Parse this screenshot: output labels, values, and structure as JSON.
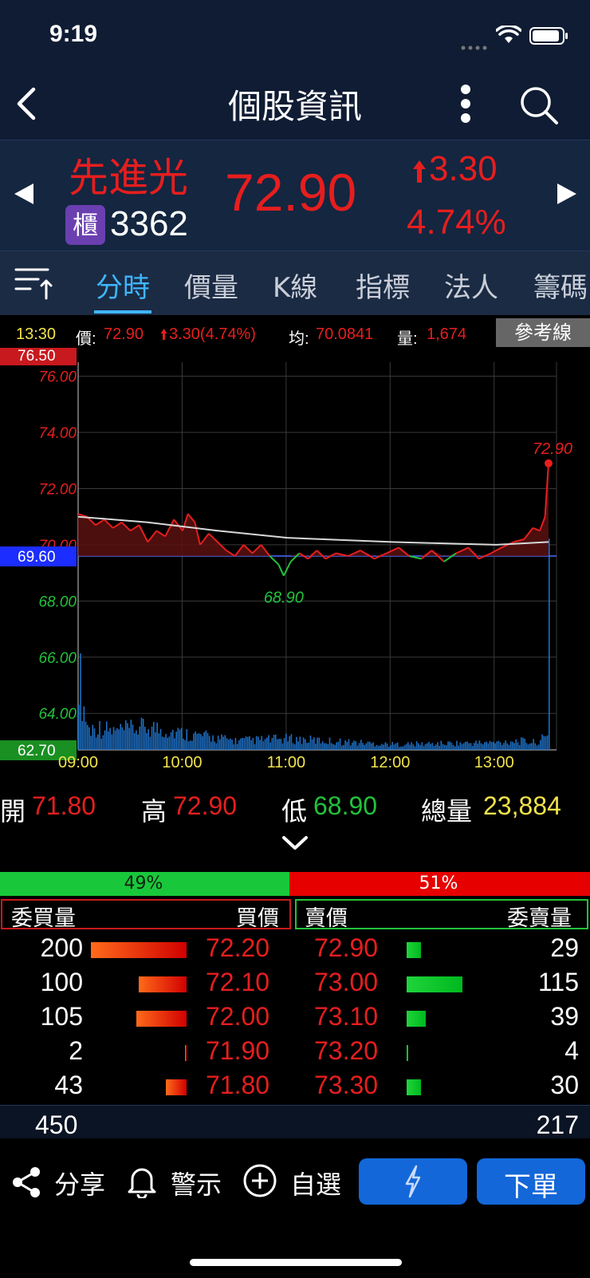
{
  "status": {
    "time": "9:19"
  },
  "nav": {
    "title": "個股資訊"
  },
  "quote": {
    "name": "先進光",
    "market_badge": "櫃",
    "code": "3362",
    "price": "72.90",
    "change": "3.30",
    "change_pct": "4.74%"
  },
  "tabs": [
    "分時",
    "價量",
    "K線",
    "指標",
    "法人",
    "籌碼"
  ],
  "info": {
    "time": "13:30",
    "price_label": "價:",
    "price": "72.90",
    "change": "3.30(4.74%)",
    "avg_label": "均:",
    "avg": "70.0841",
    "vol_label": "量:",
    "vol": "1,674",
    "ref_button": "參考線"
  },
  "chart_data": {
    "type": "line",
    "x_ticks": [
      "09:00",
      "10:00",
      "11:00",
      "12:00",
      "13:00"
    ],
    "y_ticks": [
      "76.00",
      "74.00",
      "72.00",
      "70.00",
      "68.00",
      "66.00",
      "64.00"
    ],
    "ylim": [
      62.7,
      76.5
    ],
    "reference": 69.6,
    "top_label": "76.50",
    "ref_label": "69.60",
    "bottom_label": "62.70",
    "low_label": "68.90",
    "last_label": "72.90",
    "colors": {
      "up": "#e61e1e",
      "down": "#22c23b",
      "avg": "#d8d8d8",
      "volume": "#1e6fc4"
    },
    "price_series": [
      {
        "t": 0,
        "v": 71.1
      },
      {
        "t": 5,
        "v": 71.0
      },
      {
        "t": 10,
        "v": 70.7
      },
      {
        "t": 15,
        "v": 70.9
      },
      {
        "t": 20,
        "v": 70.6
      },
      {
        "t": 25,
        "v": 70.8
      },
      {
        "t": 30,
        "v": 70.5
      },
      {
        "t": 35,
        "v": 70.7
      },
      {
        "t": 40,
        "v": 70.1
      },
      {
        "t": 45,
        "v": 70.5
      },
      {
        "t": 50,
        "v": 70.3
      },
      {
        "t": 55,
        "v": 70.9
      },
      {
        "t": 60,
        "v": 70.5
      },
      {
        "t": 63,
        "v": 71.1
      },
      {
        "t": 67,
        "v": 70.8
      },
      {
        "t": 70,
        "v": 70.0
      },
      {
        "t": 75,
        "v": 70.4
      },
      {
        "t": 80,
        "v": 70.1
      },
      {
        "t": 85,
        "v": 69.8
      },
      {
        "t": 90,
        "v": 69.6
      },
      {
        "t": 95,
        "v": 70.0
      },
      {
        "t": 100,
        "v": 69.7
      },
      {
        "t": 105,
        "v": 70.0
      },
      {
        "t": 110,
        "v": 69.6
      },
      {
        "t": 115,
        "v": 69.3
      },
      {
        "t": 118,
        "v": 68.9
      },
      {
        "t": 122,
        "v": 69.4
      },
      {
        "t": 127,
        "v": 69.7
      },
      {
        "t": 132,
        "v": 69.5
      },
      {
        "t": 137,
        "v": 69.8
      },
      {
        "t": 142,
        "v": 69.5
      },
      {
        "t": 148,
        "v": 69.7
      },
      {
        "t": 155,
        "v": 69.6
      },
      {
        "t": 162,
        "v": 69.8
      },
      {
        "t": 170,
        "v": 69.5
      },
      {
        "t": 177,
        "v": 69.7
      },
      {
        "t": 184,
        "v": 69.9
      },
      {
        "t": 190,
        "v": 69.6
      },
      {
        "t": 197,
        "v": 69.5
      },
      {
        "t": 203,
        "v": 69.8
      },
      {
        "t": 210,
        "v": 69.4
      },
      {
        "t": 217,
        "v": 69.7
      },
      {
        "t": 224,
        "v": 69.9
      },
      {
        "t": 230,
        "v": 69.5
      },
      {
        "t": 237,
        "v": 69.7
      },
      {
        "t": 243,
        "v": 69.9
      },
      {
        "t": 250,
        "v": 70.1
      },
      {
        "t": 256,
        "v": 70.2
      },
      {
        "t": 261,
        "v": 70.6
      },
      {
        "t": 265,
        "v": 70.5
      },
      {
        "t": 268,
        "v": 71.0
      },
      {
        "t": 270,
        "v": 72.9
      }
    ],
    "avg_series": [
      {
        "t": 0,
        "v": 71.0
      },
      {
        "t": 40,
        "v": 70.8
      },
      {
        "t": 80,
        "v": 70.5
      },
      {
        "t": 120,
        "v": 70.25
      },
      {
        "t": 180,
        "v": 70.1
      },
      {
        "t": 240,
        "v": 70.0
      },
      {
        "t": 270,
        "v": 70.1
      }
    ],
    "volume_profile": [
      {
        "t": 0,
        "h": 0.95
      },
      {
        "t": 2,
        "h": 0.55
      },
      {
        "t": 4,
        "h": 0.35
      },
      {
        "t": 6,
        "h": 0.22
      },
      {
        "t": 10,
        "h": 0.25
      },
      {
        "t": 20,
        "h": 0.2
      },
      {
        "t": 40,
        "h": 0.25
      },
      {
        "t": 60,
        "h": 0.18
      },
      {
        "t": 90,
        "h": 0.1
      },
      {
        "t": 120,
        "h": 0.12
      },
      {
        "t": 180,
        "h": 0.06
      },
      {
        "t": 240,
        "h": 0.08
      },
      {
        "t": 250,
        "h": 0.1
      },
      {
        "t": 262,
        "h": 0.08
      },
      {
        "t": 270,
        "h": 0.15
      }
    ],
    "last_volume_spike": 0.82
  },
  "summary": {
    "open_label": "開",
    "open": "71.80",
    "high_label": "高",
    "high": "72.90",
    "low_label": "低",
    "low": "68.90",
    "total_label": "總量",
    "total": "23,884"
  },
  "ratio": {
    "buy_pct_text": "49%",
    "sell_pct_text": "51%",
    "buy_fraction": 0.49
  },
  "book": {
    "headers": {
      "bid_qty": "委買量",
      "bid_price": "買價",
      "ask_price": "賣價",
      "ask_qty": "委賣量"
    },
    "rows": [
      {
        "bid_qty": "200",
        "bid_price": "72.20",
        "ask_price": "72.90",
        "ask_qty": "29"
      },
      {
        "bid_qty": "100",
        "bid_price": "72.10",
        "ask_price": "73.00",
        "ask_qty": "115"
      },
      {
        "bid_qty": "105",
        "bid_price": "72.00",
        "ask_price": "73.10",
        "ask_qty": "39"
      },
      {
        "bid_qty": "2",
        "bid_price": "71.90",
        "ask_price": "73.20",
        "ask_qty": "4"
      },
      {
        "bid_qty": "43",
        "bid_price": "71.80",
        "ask_price": "73.30",
        "ask_qty": "30"
      }
    ],
    "bid_total": "450",
    "ask_total": "217"
  },
  "bottom": {
    "share": "分享",
    "alert": "警示",
    "watch": "自選",
    "order": "下單"
  },
  "colors": {
    "red": "#e61e1e",
    "green": "#22c23b",
    "yellow": "#f2e34a",
    "blue": "#1467d8"
  }
}
